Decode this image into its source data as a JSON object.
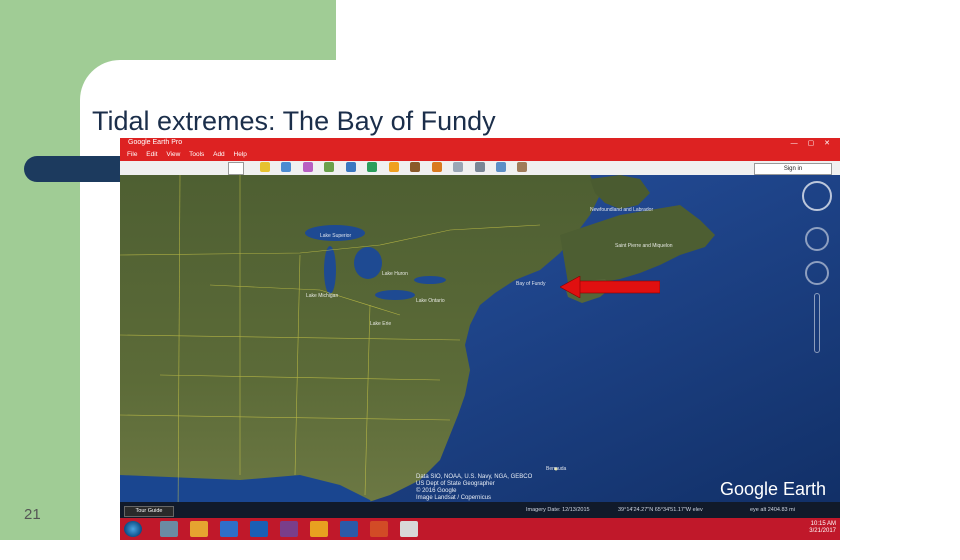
{
  "slide": {
    "title": "Tidal extremes: The Bay of Fundy",
    "number": "21"
  },
  "app": {
    "title": "Google Earth Pro",
    "window_controls": "— ▢ ✕",
    "menu": [
      "File",
      "Edit",
      "View",
      "Tools",
      "Add",
      "Help"
    ],
    "signin_label": "Sign in",
    "toolbar_icons": [
      "search-icon",
      "placemark-icon",
      "polygon-icon",
      "path-icon",
      "overlay-icon",
      "tour-icon",
      "history-icon",
      "sun-icon",
      "planets-icon",
      "ruler-icon",
      "email-icon",
      "print-icon",
      "save-image-icon",
      "map-icon"
    ]
  },
  "map": {
    "labels": [
      "Newfoundland and Labrador",
      "Saint Pierre and Miquelon",
      "Bay of Fundy",
      "Lake Superior",
      "Lake Michigan",
      "Lake Huron",
      "Lake Erie",
      "Lake Ontario",
      "Bermuda"
    ],
    "attribution": [
      "Data SIO, NOAA, U.S. Navy, NGA, GEBCO",
      "US Dept of State Geographer",
      "© 2016 Google",
      "Image Landsat / Copernicus"
    ],
    "logo": "Google Earth"
  },
  "statusbar": {
    "tour_guide": "Tour Guide",
    "imagery_date": "Imagery Date: 12/13/2015",
    "coords": "39°14'24.27\"N  65°34'51.17\"W  elev",
    "eye_alt": "eye alt 2404.83 mi"
  },
  "taskbar": {
    "time": "10:15 AM",
    "date": "3/21/2017"
  },
  "colors": {
    "title_bar": "#dd2222",
    "ocean": "#1a3d7c",
    "land": "#5b6a3a",
    "arrow": "#e01010",
    "slide_green": "#a0cc95"
  }
}
